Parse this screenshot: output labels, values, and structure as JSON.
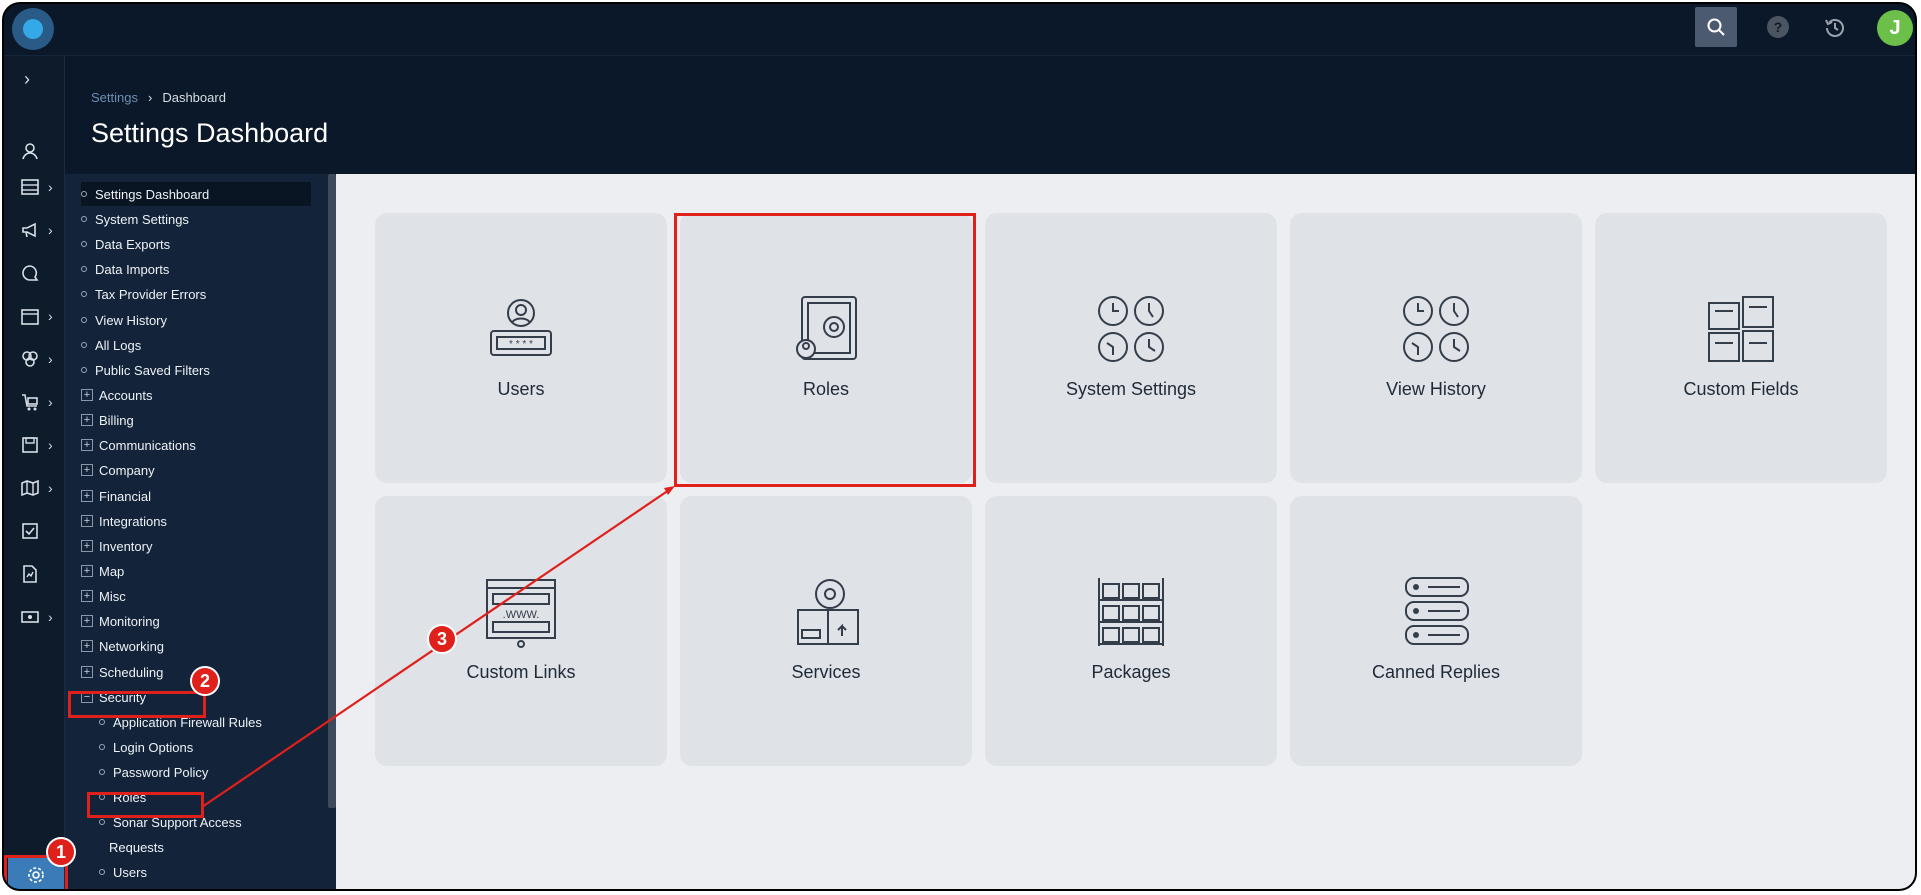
{
  "topbar": {
    "help_label": "?",
    "avatar_initial": "J"
  },
  "header": {
    "breadcrumb_root": "Settings",
    "breadcrumb_sep": "›",
    "breadcrumb_current": "Dashboard",
    "title": "Settings Dashboard"
  },
  "rail": {
    "expand_label": "›",
    "chev": "›"
  },
  "tree": {
    "items": [
      {
        "label": "Settings Dashboard",
        "kind": "leaf"
      },
      {
        "label": "System Settings",
        "kind": "leaf"
      },
      {
        "label": "Data Exports",
        "kind": "leaf"
      },
      {
        "label": "Data Imports",
        "kind": "leaf"
      },
      {
        "label": "Tax Provider Errors",
        "kind": "leaf"
      },
      {
        "label": "View History",
        "kind": "leaf"
      },
      {
        "label": "All Logs",
        "kind": "leaf"
      },
      {
        "label": "Public Saved Filters",
        "kind": "leaf"
      },
      {
        "label": "Accounts",
        "kind": "group"
      },
      {
        "label": "Billing",
        "kind": "group"
      },
      {
        "label": "Communications",
        "kind": "group"
      },
      {
        "label": "Company",
        "kind": "group"
      },
      {
        "label": "Financial",
        "kind": "group"
      },
      {
        "label": "Integrations",
        "kind": "group"
      },
      {
        "label": "Inventory",
        "kind": "group"
      },
      {
        "label": "Map",
        "kind": "group"
      },
      {
        "label": "Misc",
        "kind": "group"
      },
      {
        "label": "Monitoring",
        "kind": "group"
      },
      {
        "label": "Networking",
        "kind": "group"
      },
      {
        "label": "Scheduling",
        "kind": "group"
      },
      {
        "label": "Security",
        "kind": "group-open"
      },
      {
        "label": "Application Firewall Rules",
        "kind": "sub"
      },
      {
        "label": "Login Options",
        "kind": "sub"
      },
      {
        "label": "Password Policy",
        "kind": "sub"
      },
      {
        "label": "Roles",
        "kind": "sub"
      },
      {
        "label": "Sonar Support Access",
        "kind": "sub"
      },
      {
        "label": "Requests",
        "kind": "sub-cont"
      },
      {
        "label": "Users",
        "kind": "sub"
      }
    ],
    "plus_symbol": "+",
    "minus_symbol": "−"
  },
  "cards": [
    {
      "label": "Users",
      "icon": "user-password-icon"
    },
    {
      "label": "Roles",
      "icon": "safe-icon"
    },
    {
      "label": "System Settings",
      "icon": "clocks-icon"
    },
    {
      "label": "View History",
      "icon": "clocks-icon"
    },
    {
      "label": "Custom Fields",
      "icon": "puzzle-form-icon"
    },
    {
      "label": "Custom Links",
      "icon": "browser-www-icon"
    },
    {
      "label": "Services",
      "icon": "tape-box-icon"
    },
    {
      "label": "Packages",
      "icon": "shelves-icon"
    },
    {
      "label": "Canned Replies",
      "icon": "chat-bubbles-icon"
    }
  ],
  "annotations": {
    "badge_1": "1",
    "badge_2": "2",
    "badge_3": "3",
    "color": "#e0201b"
  }
}
